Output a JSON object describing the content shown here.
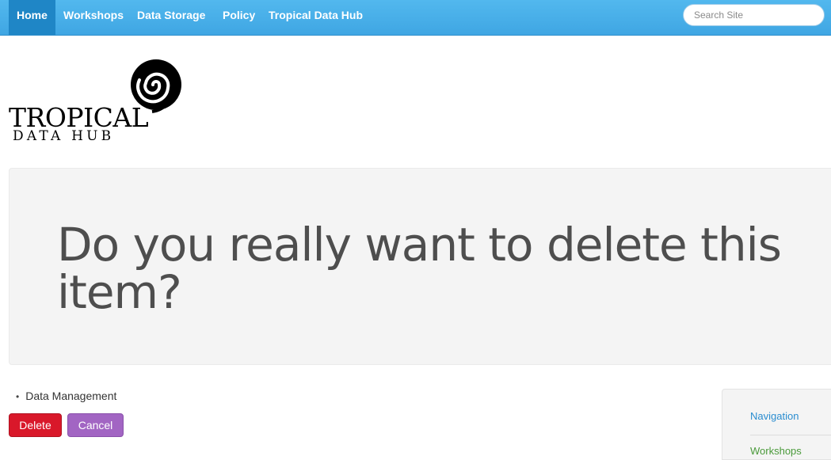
{
  "navbar": {
    "items": [
      {
        "label": "Home",
        "active": true
      },
      {
        "label": "Workshops",
        "active": false
      },
      {
        "label": "Data Storage",
        "active": false
      },
      {
        "label": "Policy",
        "active": false
      },
      {
        "label": "Tropical Data Hub",
        "active": false
      }
    ],
    "search_placeholder": "Search Site"
  },
  "logo": {
    "line1": "TROPICAL",
    "line2": "DATA HUB"
  },
  "hero": {
    "title": "Do you really want to delete this item?"
  },
  "breadcrumb": {
    "items": [
      "Data Management"
    ]
  },
  "buttons": {
    "delete_label": "Delete",
    "cancel_label": "Cancel"
  },
  "sidebar": {
    "items": [
      {
        "label": "Navigation"
      },
      {
        "label": "Workshops"
      }
    ]
  },
  "colors": {
    "navbar": "#3fa6e3",
    "navbar_active": "#1f86c6",
    "delete": "#d9182a",
    "cancel": "#a265c3",
    "link": "#2a8dd0"
  }
}
